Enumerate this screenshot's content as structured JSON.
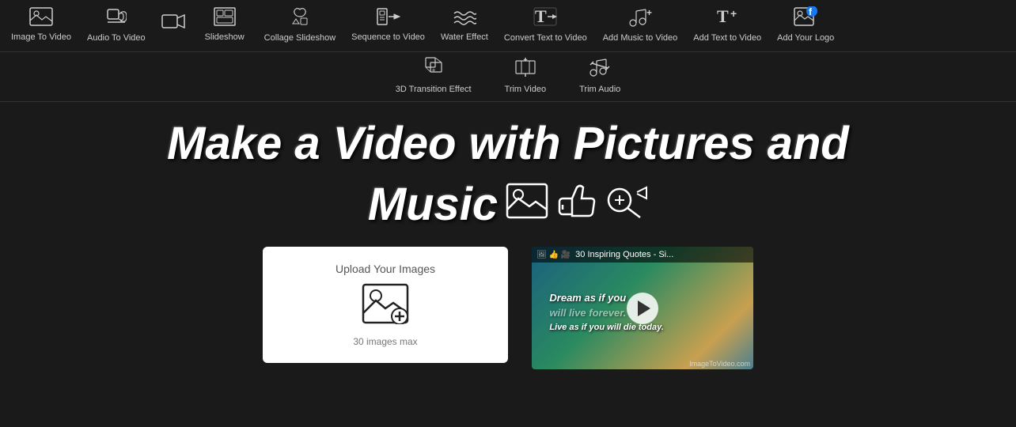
{
  "nav": {
    "items": [
      {
        "id": "image-to-video",
        "label": "Image To Video",
        "icon": "🖼"
      },
      {
        "id": "audio-to-video",
        "label": "Audio To Video",
        "icon": "👍"
      },
      {
        "id": "video-capture",
        "label": "",
        "icon": "🎥"
      },
      {
        "id": "slideshow",
        "label": "Slideshow",
        "icon": "📋"
      },
      {
        "id": "collage-slideshow",
        "label": "Collage Slideshow",
        "icon": "👍"
      },
      {
        "id": "sequence-to-video",
        "label": "Sequence to Video",
        "icon": "🎞"
      },
      {
        "id": "water-effect",
        "label": "Water Effect",
        "icon": "≋"
      },
      {
        "id": "convert-text-to-video",
        "label": "Convert Text to Video",
        "icon": "T"
      },
      {
        "id": "add-music-to-video",
        "label": "Add Music to Video",
        "icon": "🎵"
      },
      {
        "id": "add-text-to-video",
        "label": "Add Text to Video",
        "icon": "T+"
      },
      {
        "id": "add-your-logo",
        "label": "Add Your Logo",
        "icon": "🖼"
      }
    ],
    "second_row": [
      {
        "id": "3d-transition",
        "label": "3D Transition Effect",
        "icon": "✦"
      },
      {
        "id": "trim-video",
        "label": "Trim Video",
        "icon": "✂"
      },
      {
        "id": "trim-audio",
        "label": "Trim Audio",
        "icon": "✂"
      }
    ]
  },
  "hero": {
    "title_line1": "Make a Video with Pictures and",
    "title_line2": "Music"
  },
  "upload": {
    "label": "Upload Your Images",
    "max_text": "30 images max"
  },
  "video_preview": {
    "title_icons": "🖼 👍 📷",
    "title_text": "30 Inspiring Quotes - Si...",
    "overlay_line1": "Dream as if you",
    "overlay_line2": "will live forever.",
    "overlay_line3": "Live as if you will die today.",
    "footer": "ImageToVideo.com"
  }
}
